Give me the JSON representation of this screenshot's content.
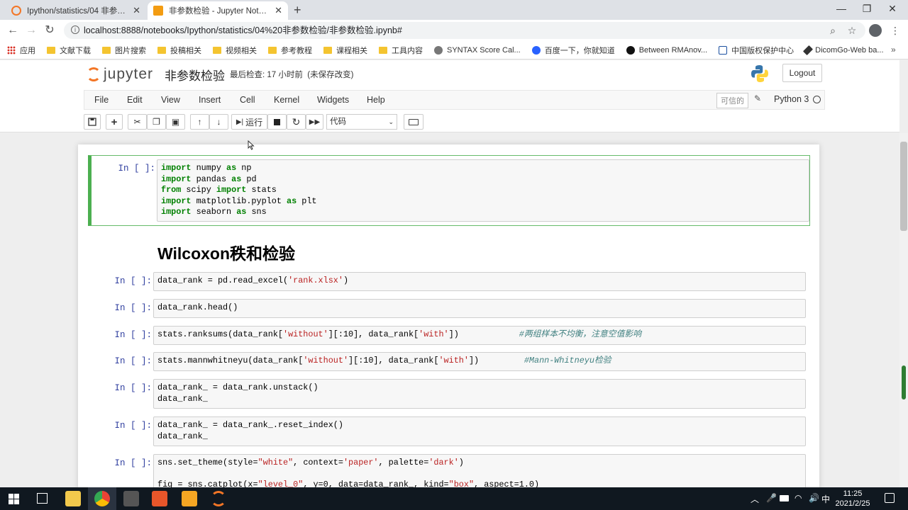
{
  "browser": {
    "tabs": [
      {
        "title": "Ipython/statistics/04 非参数检验/",
        "active": false
      },
      {
        "title": "非参数检验 - Jupyter Notebook",
        "active": true
      }
    ],
    "url": "localhost:8888/notebooks/Ipython/statistics/04%20非参数检验/非参数检验.ipynb#",
    "bookmarks": [
      {
        "label": "应用",
        "type": "apps"
      },
      {
        "label": "文献下载",
        "type": "folder"
      },
      {
        "label": "图片搜索",
        "type": "folder"
      },
      {
        "label": "投稿相关",
        "type": "folder"
      },
      {
        "label": "视频相关",
        "type": "folder"
      },
      {
        "label": "参考教程",
        "type": "folder"
      },
      {
        "label": "课程相关",
        "type": "folder"
      },
      {
        "label": "工具内容",
        "type": "folder"
      },
      {
        "label": "SYNTAX Score Cal...",
        "type": "site"
      },
      {
        "label": "百度一下，你就知道",
        "type": "site"
      },
      {
        "label": "Between RMAnov...",
        "type": "site"
      },
      {
        "label": "中国版权保护中心",
        "type": "site"
      },
      {
        "label": "DicomGo-Web ba...",
        "type": "site"
      }
    ]
  },
  "jupyter": {
    "logo_text": "jupyter",
    "notebook_title": "非参数检验",
    "checkpoint": "最后检查: 17 小时前",
    "unsaved": "(未保存改变)",
    "logout": "Logout",
    "menu": [
      "File",
      "Edit",
      "View",
      "Insert",
      "Cell",
      "Kernel",
      "Widgets",
      "Help"
    ],
    "trusted": "可信的",
    "kernel": "Python 3",
    "toolbar": {
      "run": "运行",
      "cell_type": "代码"
    }
  },
  "cells": {
    "prompt": "In  [ ]:",
    "markdown_heading": "Wilcoxon秩和检验"
  },
  "taskbar": {
    "ime": "中",
    "time": "11:25",
    "date": "2021/2/25"
  }
}
